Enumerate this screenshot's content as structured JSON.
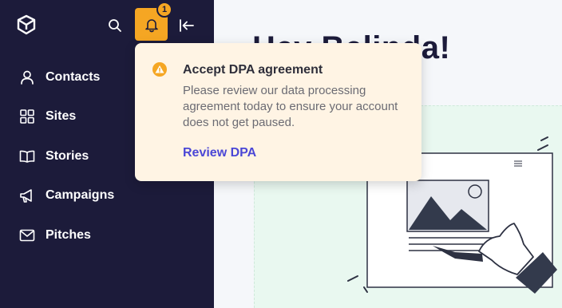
{
  "sidebar": {
    "notification_count": "1",
    "items": [
      {
        "label": "Contacts",
        "icon": "user-icon"
      },
      {
        "label": "Sites",
        "icon": "grid-icon"
      },
      {
        "label": "Stories",
        "icon": "book-icon"
      },
      {
        "label": "Campaigns",
        "icon": "megaphone-icon"
      },
      {
        "label": "Pitches",
        "icon": "mail-icon"
      }
    ]
  },
  "main": {
    "heading": "Hey Belinda!"
  },
  "popover": {
    "title": "Accept DPA agreement",
    "message": "Please review our data processing agreement today to ensure your account does not get paused.",
    "link": "Review DPA"
  },
  "colors": {
    "sidebar_bg": "#1c1b3a",
    "accent": "#f5a623",
    "link": "#4b47d6",
    "popover_bg": "#fff4e4"
  }
}
